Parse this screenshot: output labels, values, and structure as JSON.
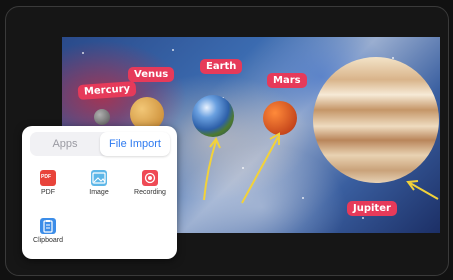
{
  "canvas": {
    "labels": {
      "mercury": "Mercury",
      "venus": "Venus",
      "earth": "Earth",
      "mars": "Mars",
      "jupiter": "Jupiter"
    }
  },
  "colors": {
    "tag": "#e63a5a",
    "accent": "#2f7bf0",
    "arrow": "#f2d23a"
  },
  "panel": {
    "tabs": [
      "Apps",
      "File Import"
    ],
    "active_tab": "File Import",
    "items": [
      {
        "label": "PDF",
        "icon": "pdf-icon"
      },
      {
        "label": "Image",
        "icon": "image-icon"
      },
      {
        "label": "Recording",
        "icon": "record-icon"
      },
      {
        "label": "Clipboard",
        "icon": "clipboard-icon"
      }
    ]
  }
}
